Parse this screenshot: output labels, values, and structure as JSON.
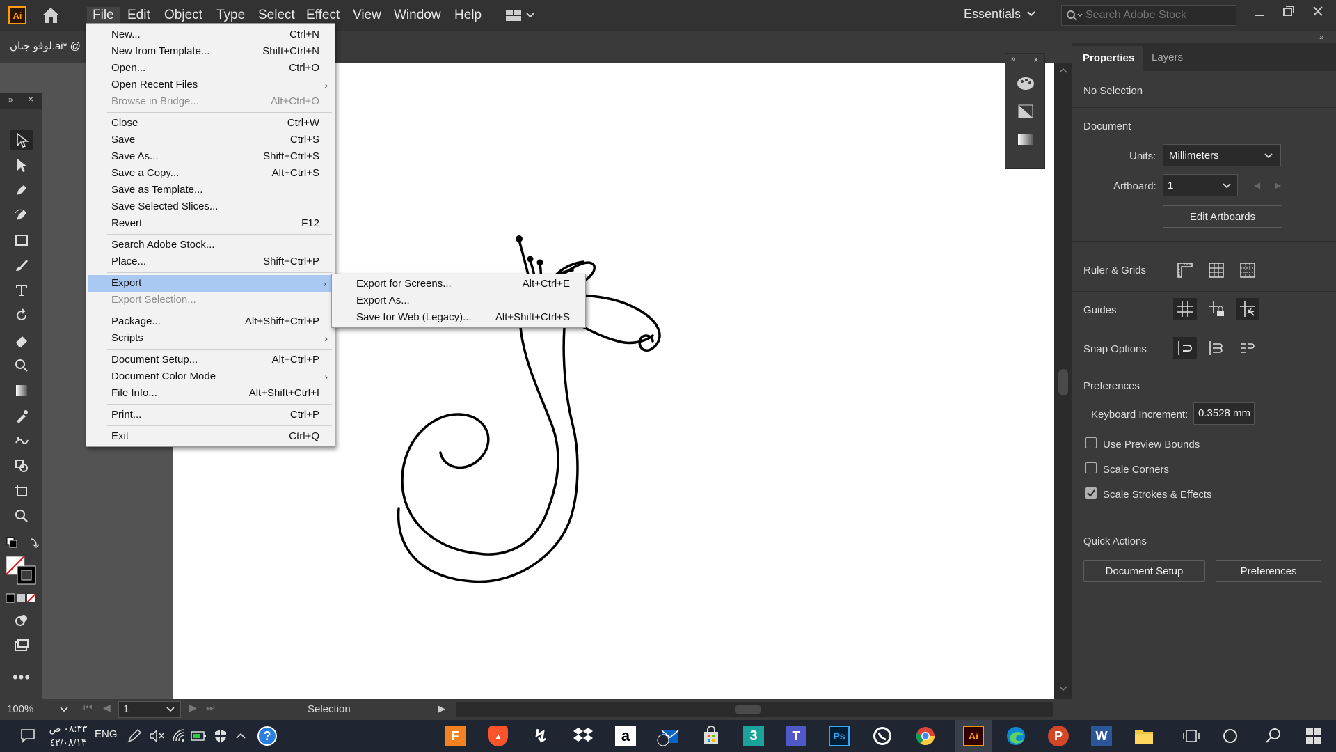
{
  "app": {
    "logo": "Ai",
    "title": "Adobe Illustrator"
  },
  "menubar": [
    "File",
    "Edit",
    "Object",
    "Type",
    "Select",
    "Effect",
    "View",
    "Window",
    "Help"
  ],
  "workspace": "Essentials",
  "search": {
    "placeholder": "Search Adobe Stock"
  },
  "document_tab": {
    "title": "لوقو جنان.ai* @"
  },
  "file_menu": [
    {
      "label": "New...",
      "shortcut": "Ctrl+N"
    },
    {
      "label": "New from Template...",
      "shortcut": "Shift+Ctrl+N"
    },
    {
      "label": "Open...",
      "shortcut": "Ctrl+O"
    },
    {
      "label": "Open Recent Files",
      "shortcut": "",
      "submenu": true
    },
    {
      "label": "Browse in Bridge...",
      "shortcut": "Alt+Ctrl+O",
      "disabled": true
    },
    {
      "label": "Close",
      "shortcut": "Ctrl+W"
    },
    {
      "label": "Save",
      "shortcut": "Ctrl+S"
    },
    {
      "label": "Save As...",
      "shortcut": "Shift+Ctrl+S"
    },
    {
      "label": "Save a Copy...",
      "shortcut": "Alt+Ctrl+S"
    },
    {
      "label": "Save as Template...",
      "shortcut": ""
    },
    {
      "label": "Save Selected Slices...",
      "shortcut": ""
    },
    {
      "label": "Revert",
      "shortcut": "F12"
    },
    {
      "label": "Search Adobe Stock...",
      "shortcut": ""
    },
    {
      "label": "Place...",
      "shortcut": "Shift+Ctrl+P"
    },
    {
      "label": "Export",
      "shortcut": "",
      "submenu": true,
      "highlighted": true
    },
    {
      "label": "Export Selection...",
      "shortcut": "",
      "disabled": true
    },
    {
      "label": "Package...",
      "shortcut": "Alt+Shift+Ctrl+P"
    },
    {
      "label": "Scripts",
      "shortcut": "",
      "submenu": true
    },
    {
      "label": "Document Setup...",
      "shortcut": "Alt+Ctrl+P"
    },
    {
      "label": "Document Color Mode",
      "shortcut": "",
      "submenu": true
    },
    {
      "label": "File Info...",
      "shortcut": "Alt+Shift+Ctrl+I"
    },
    {
      "label": "Print...",
      "shortcut": "Ctrl+P"
    },
    {
      "label": "Exit",
      "shortcut": "Ctrl+Q"
    }
  ],
  "export_submenu": [
    {
      "label": "Export for Screens...",
      "shortcut": "Alt+Ctrl+E"
    },
    {
      "label": "Export As...",
      "shortcut": ""
    },
    {
      "label": "Save for Web (Legacy)...",
      "shortcut": "Alt+Shift+Ctrl+S"
    }
  ],
  "properties": {
    "tabs": [
      "Properties",
      "Layers"
    ],
    "selection": "No Selection",
    "document_heading": "Document",
    "units_label": "Units:",
    "units_value": "Millimeters",
    "artboard_label": "Artboard:",
    "artboard_value": "1",
    "edit_artboards": "Edit Artboards",
    "ruler_grids": "Ruler & Grids",
    "guides": "Guides",
    "snap_options": "Snap Options",
    "preferences_heading": "Preferences",
    "keyboard_increment_label": "Keyboard Increment:",
    "keyboard_increment_value": "0.3528 mm",
    "use_preview_bounds": "Use Preview Bounds",
    "use_preview_bounds_checked": false,
    "scale_corners": "Scale Corners",
    "scale_corners_checked": false,
    "scale_strokes": "Scale Strokes & Effects",
    "scale_strokes_checked": true,
    "quick_actions": "Quick Actions",
    "document_setup_btn": "Document Setup",
    "preferences_btn": "Preferences"
  },
  "status": {
    "zoom": "100%",
    "artboard": "1",
    "tool": "Selection"
  },
  "taskbar": {
    "time": "٠٨:٣٣ ص",
    "date": "٤٢/٠٨/١٣",
    "language": "ENG",
    "apps": [
      "Fusion",
      "Brave",
      "Sketch",
      "Dropbox",
      "Amazon",
      "Mail",
      "Store",
      "3ds Max",
      "Teams",
      "Photoshop",
      "WhatsApp",
      "Chrome",
      "Illustrator",
      "Edge",
      "PowerPoint",
      "Word",
      "File Explorer"
    ]
  },
  "colors": {
    "accent_menu_highlight": "#a9c9f2",
    "app_orange": "#ff9a00",
    "panel_bg": "#3a3a3a"
  }
}
